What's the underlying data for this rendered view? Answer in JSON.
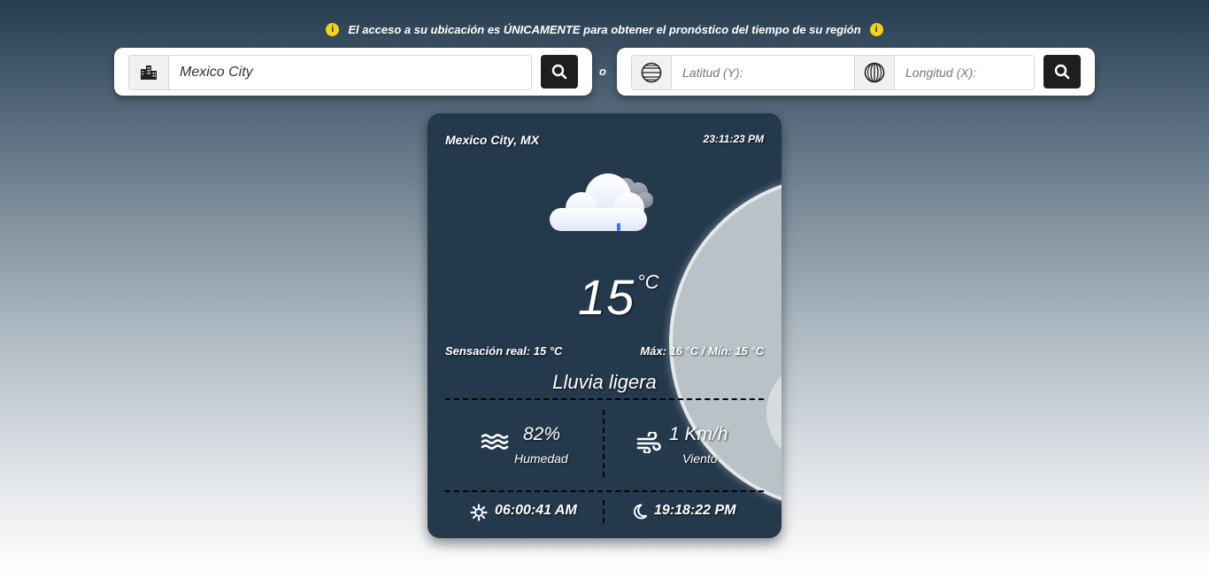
{
  "notice": {
    "text": "El acceso a su ubicación es ÚNICAMENTE para obtener el pronóstico del tiempo de su región",
    "icon_left": "info-icon",
    "icon_right": "info-icon",
    "icon_color": "#f2d21b"
  },
  "city_search": {
    "icon": "city-buildings-icon",
    "value": "Mexico City",
    "button_icon": "search-icon"
  },
  "separator": "o",
  "coord_search": {
    "lat_icon": "latitude-globe-icon",
    "lat_placeholder": "Latitud (Y):",
    "lon_icon": "longitude-globe-icon",
    "lon_placeholder": "Longitud (X):",
    "button_icon": "search-icon"
  },
  "weather": {
    "location": "Mexico City, MX",
    "time": "23:11:23 PM",
    "condition_icon": "cloud-rain-icon",
    "temperature": "15",
    "temperature_unit": "°C",
    "feels_like": "Sensación real: 15 °C",
    "max_min": "Máx: 16 °C / Mín: 15 °C",
    "description": "Lluvia ligera",
    "humidity": {
      "icon": "humidity-waves-icon",
      "value": "82%",
      "label": "Humedad"
    },
    "wind": {
      "icon": "wind-icon",
      "value": "1 Km/h",
      "label": "Viento"
    },
    "sunrise": {
      "icon": "sun-icon",
      "value": "06:00:41 AM"
    },
    "sunset": {
      "icon": "moon-icon",
      "value": "19:18:22 PM"
    },
    "card_color": "#24394c"
  }
}
